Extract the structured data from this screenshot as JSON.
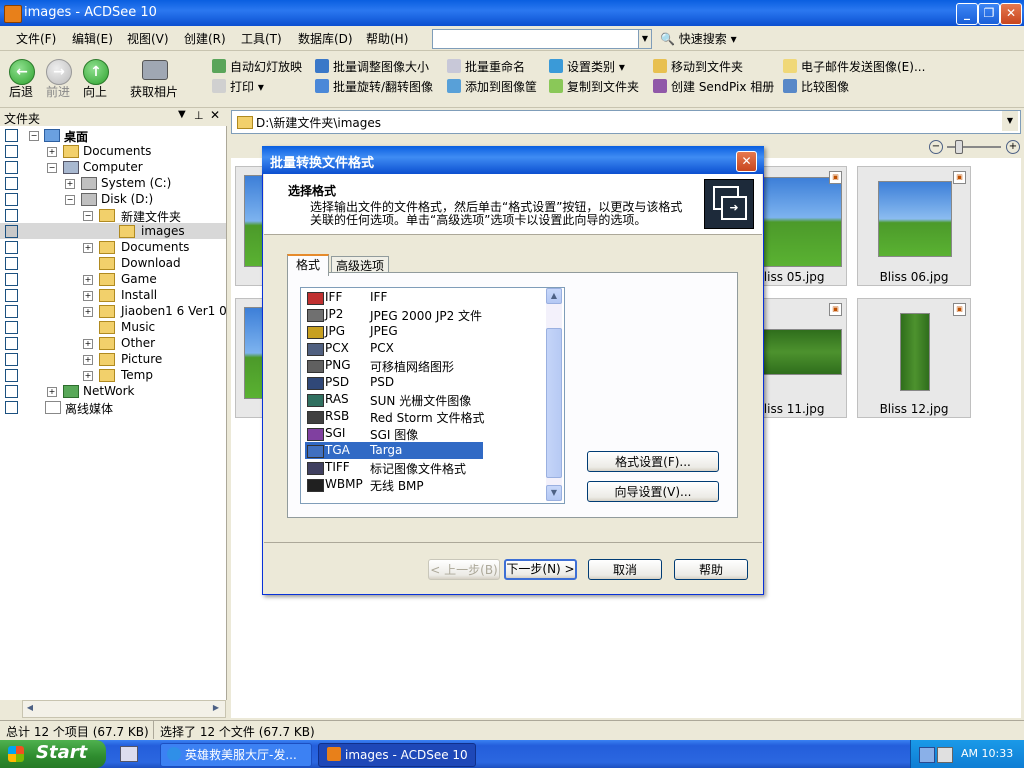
{
  "window": {
    "title": "images - ACDSee 10"
  },
  "menu": [
    "文件(F)",
    "编辑(E)",
    "视图(V)",
    "创建(R)",
    "工具(T)",
    "数据库(D)",
    "帮助(H)"
  ],
  "quick_search": "快速搜索",
  "toolbar": {
    "back": "后退",
    "forward": "前进",
    "up": "向上",
    "acquire": "获取相片",
    "row1": [
      "自动幻灯放映",
      "批量调整图像大小",
      "批量重命名",
      "设置类别",
      "移动到文件夹",
      "电子邮件发送图像(E)..."
    ],
    "row2": [
      "打印",
      "批量旋转/翻转图像",
      "添加到图像筐",
      "复制到文件夹",
      "创建 SendPix 相册",
      "比较图像"
    ]
  },
  "folders": {
    "header": "文件夹",
    "items": [
      "桌面",
      "Documents",
      "Computer",
      "System (C:)",
      "Disk (D:)",
      "新建文件夹",
      "images",
      "Documents",
      "Download",
      "Game",
      "Install",
      "Jiaoben1 6 Ver1 0",
      "Music",
      "Other",
      "Picture",
      "Temp",
      "NetWork",
      "离线媒体"
    ]
  },
  "address": "D:\\新建文件夹\\images",
  "thumbnails": [
    "Bliss 05.jpg",
    "Bliss 06.jpg",
    "Bliss 11.jpg",
    "Bliss 12.jpg"
  ],
  "status": {
    "total": "总计 12 个项目 (67.7 KB)",
    "selected": "选择了 12 个文件 (67.7 KB)"
  },
  "taskbar": {
    "start": "Start",
    "tasks": [
      "英雄救美服大厅-发...",
      "images - ACDSee 10"
    ],
    "clock": "AM 10:33"
  },
  "dialog": {
    "title": "批量转换文件格式",
    "heading": "选择格式",
    "description_line1": "选择输出文件的文件格式，然后单击“格式设置”按钮，以更改与该格式",
    "description_line2": "关联的任何选项。单击“高级选项”选项卡以设置此向导的选项。",
    "tabs": [
      "格式",
      "高级选项"
    ],
    "formats": [
      {
        "code": "IFF",
        "desc": "IFF"
      },
      {
        "code": "JP2",
        "desc": "JPEG 2000 JP2 文件"
      },
      {
        "code": "JPG",
        "desc": "JPEG"
      },
      {
        "code": "PCX",
        "desc": "PCX"
      },
      {
        "code": "PNG",
        "desc": "可移植网络图形"
      },
      {
        "code": "PSD",
        "desc": "PSD"
      },
      {
        "code": "RAS",
        "desc": "SUN 光栅文件图像"
      },
      {
        "code": "RSB",
        "desc": "Red Storm 文件格式"
      },
      {
        "code": "SGI",
        "desc": "SGI 图像"
      },
      {
        "code": "TGA",
        "desc": "Targa"
      },
      {
        "code": "TIFF",
        "desc": "标记图像文件格式"
      },
      {
        "code": "WBMP",
        "desc": "无线 BMP"
      }
    ],
    "selected_format": "TGA",
    "format_settings": "格式设置(F)...",
    "wizard_settings": "向导设置(V)...",
    "prev": "< 上一步(B)",
    "next": "下一步(N) >",
    "cancel": "取消",
    "help": "帮助"
  },
  "colors": {
    "selection": "#316ac5",
    "titlebar": "#0a5fe0",
    "taskbar": "#245edb",
    "start": "#2e8b2e"
  }
}
